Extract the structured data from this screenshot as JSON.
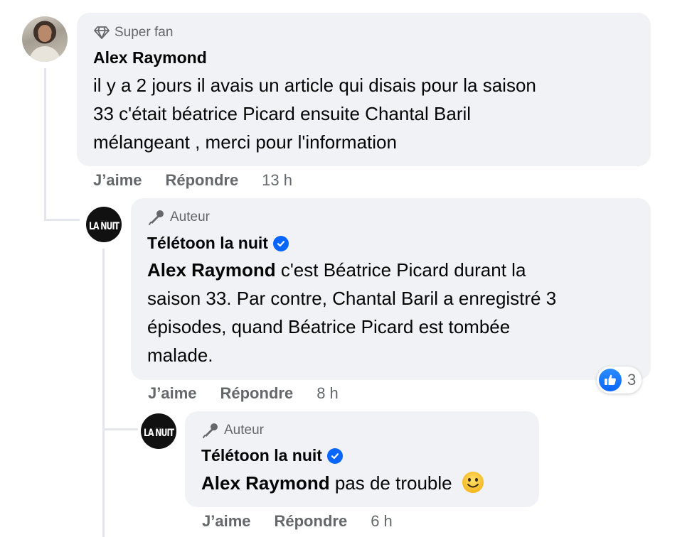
{
  "comments": [
    {
      "badge": "Super fan",
      "badge_icon": "diamond-icon",
      "author": "Alex Raymond",
      "verified": false,
      "text_lines": [
        "il y a 2 jours il avais un article qui disais pour la saison",
        "33 c'était béatrice Picard ensuite Chantal Baril",
        "mélangeant , merci pour l'information"
      ],
      "like_label": "J’aime",
      "reply_label": "Répondre",
      "time": "13 h"
    },
    {
      "badge": "Auteur",
      "badge_icon": "microphone-icon",
      "author": "Télétoon la nuit",
      "verified": true,
      "avatar_text": "LA NUIT",
      "mention": "Alex Raymond",
      "text_lines": [
        " c'est Béatrice Picard durant la",
        "saison 33. Par contre, Chantal Baril a enregistré 3",
        "épisodes, quand Béatrice Picard est tombée",
        "malade."
      ],
      "like_label": "J’aime",
      "reply_label": "Répondre",
      "time": "8 h",
      "reaction_icon": "like-icon",
      "reaction_count": "3"
    },
    {
      "badge": "Auteur",
      "badge_icon": "microphone-icon",
      "author": "Télétoon la nuit",
      "verified": true,
      "avatar_text": "LA NUIT",
      "mention": "Alex Raymond",
      "text": " pas de trouble",
      "emoji": "slightly-smiling-face",
      "like_label": "J’aime",
      "reply_label": "Répondre",
      "time": "6 h"
    }
  ],
  "colors": {
    "bubble": "#f0f2f5",
    "secondary_text": "#65676b",
    "verified_blue": "#0866ff",
    "thread_line": "#e4e6eb"
  }
}
